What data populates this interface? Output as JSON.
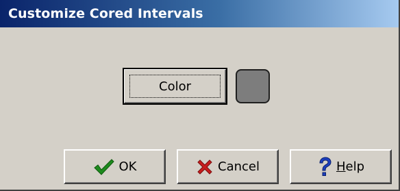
{
  "window": {
    "title": "Customize Cored Intervals"
  },
  "color_picker": {
    "button_label": "Color",
    "swatch_color": "#7d7d7d"
  },
  "buttons": {
    "ok_label": "OK",
    "cancel_label": "Cancel",
    "help_label_prefix": "",
    "help_label_mnemonic": "H",
    "help_label_rest": "elp"
  },
  "icons": {
    "ok": "checkmark-icon",
    "cancel": "red-x-icon",
    "help": "question-mark-icon"
  },
  "colors": {
    "title_gradient_start": "#0a246a",
    "title_gradient_end": "#a6caf0",
    "dialog_face": "#d4d0c8",
    "ok_icon": "#1e8a1e",
    "cancel_icon": "#c81e1e",
    "help_icon": "#1c3fbf"
  }
}
